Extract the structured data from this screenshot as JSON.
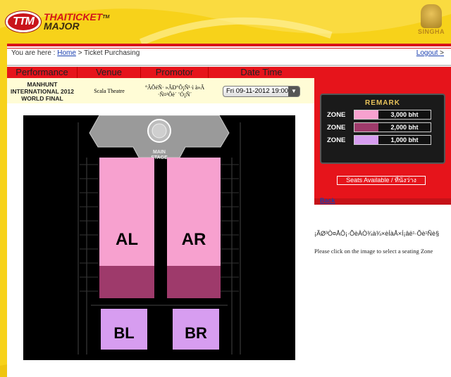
{
  "brand": {
    "logo_mark": "TTM",
    "name_line1": "THAITICKET",
    "name_line2": "MAJOR",
    "tm": "TM",
    "sponsor": "SINGHA"
  },
  "breadcrumb": {
    "prefix": "You are here :",
    "home": "Home",
    "separator": ">",
    "current": "Ticket Purchasing"
  },
  "logout": {
    "label": "Logout",
    "arrow": ">"
  },
  "table": {
    "headers": [
      "Performance",
      "Venue",
      "Promotor",
      "Date Time"
    ],
    "performance": "MANHUNT INTERNATIONAL 2012 WORLD FINAL",
    "venue": "Scala Theatre",
    "promotor": "°ÃÕéÑ· »ÃÐ°Ô¡Ñ¹·ì à»Ã ·Ñ¤¹Ôè´ ¨Ó¡Ñ´",
    "datetime_selected": "Fri 09-11-2012 19:00"
  },
  "remark": {
    "title": "REMARK",
    "zones": [
      {
        "label": "ZONE",
        "price": "3,000 bht",
        "color": "#f7a1cf"
      },
      {
        "label": "ZONE",
        "price": "2,000 bht",
        "color": "#9e3a6b"
      },
      {
        "label": "ZONE",
        "price": "1,000 bht",
        "color": "#d79df0"
      }
    ]
  },
  "seats_available": "Seats Available / ที่นั่งว่าง",
  "back": "Back",
  "map": {
    "stage_label_1": "MAIN",
    "stage_label_2": "STAGE",
    "zones": [
      {
        "name": "AL",
        "color": "#f7a1cf",
        "lower_color": "#9e3a6b"
      },
      {
        "name": "AR",
        "color": "#f7a1cf",
        "lower_color": "#9e3a6b"
      },
      {
        "name": "BL",
        "color": "#d79df0"
      },
      {
        "name": "BR",
        "color": "#d79df0"
      }
    ]
  },
  "garbled_heading": "¡ÃØ³Ò¤ÅÔ¡·ÕèÀÒ¾à¾×èÍàÅ×Í¡âë¹·Õè¹Ñè§",
  "instruction": "Please click on the image to select a seating Zone"
}
